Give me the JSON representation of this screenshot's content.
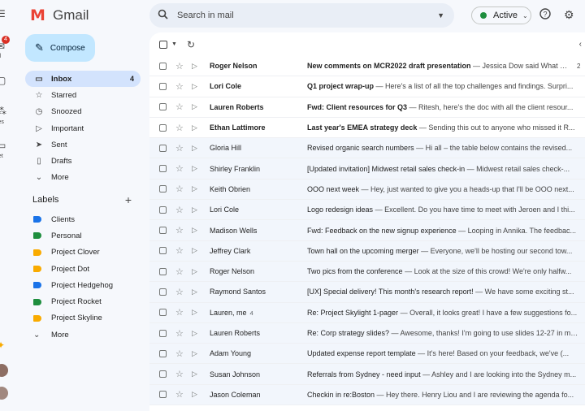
{
  "app": {
    "name": "Gmail"
  },
  "search": {
    "placeholder": "Search in mail"
  },
  "status": {
    "label": "Active",
    "color": "#1e8e3e"
  },
  "rail": {
    "items": [
      {
        "icon": "menu-icon",
        "label": ""
      },
      {
        "icon": "mail-icon",
        "label": "ail",
        "badge": "4"
      },
      {
        "icon": "chat-icon",
        "label": "at"
      },
      {
        "icon": "spaces-icon",
        "label": "ces"
      },
      {
        "icon": "meet-icon",
        "label": "eet"
      }
    ]
  },
  "compose": {
    "label": "Compose"
  },
  "nav": {
    "items": [
      {
        "label": "Inbox",
        "count": "4",
        "icon": "inbox-icon",
        "active": true
      },
      {
        "label": "Starred",
        "icon": "star-icon"
      },
      {
        "label": "Snoozed",
        "icon": "clock-icon"
      },
      {
        "label": "Important",
        "icon": "important-icon"
      },
      {
        "label": "Sent",
        "icon": "send-icon"
      },
      {
        "label": "Drafts",
        "icon": "draft-icon"
      },
      {
        "label": "More",
        "icon": "chevron-down-icon"
      }
    ]
  },
  "labels": {
    "title": "Labels",
    "items": [
      {
        "label": "Clients",
        "color": "#1a73e8"
      },
      {
        "label": "Personal",
        "color": "#1e8e3e"
      },
      {
        "label": "Project Clover",
        "color": "#f9ab00"
      },
      {
        "label": "Project Dot",
        "color": "#f9ab00"
      },
      {
        "label": "Project Hedgehog",
        "color": "#1a73e8"
      },
      {
        "label": "Project Rocket",
        "color": "#1e8e3e"
      },
      {
        "label": "Project Skyline",
        "color": "#f9ab00"
      }
    ],
    "more_label": "More"
  },
  "emails": [
    {
      "sender": "Roger Nelson",
      "subject": "New comments on MCR2022 draft presentation",
      "snippet": " — Jessica Dow said What ab...",
      "unread": true,
      "date": "2"
    },
    {
      "sender": "Lori Cole",
      "subject": "Q1 project wrap-up",
      "snippet": " — Here's a list of all the top challenges and findings. Surpri...",
      "unread": true
    },
    {
      "sender": "Lauren Roberts",
      "subject": "Fwd: Client resources for Q3",
      "snippet": " — Ritesh, here's the doc with all the client resour...",
      "unread": true
    },
    {
      "sender": "Ethan Lattimore",
      "subject": "Last year's EMEA strategy deck",
      "snippet": " — Sending this out to anyone who missed it R...",
      "unread": true
    },
    {
      "sender": "Gloria Hill",
      "subject": "Revised organic search numbers",
      "snippet": " — Hi all – the table below contains the revised...",
      "unread": false
    },
    {
      "sender": "Shirley Franklin",
      "subject": "[Updated invitation] Midwest retail sales check-in",
      "snippet": " — Midwest retail sales check-...",
      "unread": false
    },
    {
      "sender": "Keith Obrien",
      "subject": "OOO next week",
      "snippet": " — Hey, just wanted to give you a heads-up that I'll be OOO next...",
      "unread": false
    },
    {
      "sender": "Lori Cole",
      "subject": "Logo redesign ideas",
      "snippet": " — Excellent. Do you have time to meet with Jeroen and I thi...",
      "unread": false
    },
    {
      "sender": "Madison Wells",
      "subject": "Fwd: Feedback on the new signup experience",
      "snippet": " — Looping in Annika. The feedbac...",
      "unread": false
    },
    {
      "sender": "Jeffrey Clark",
      "subject": "Town hall on the upcoming merger",
      "snippet": " — Everyone, we'll be hosting our second tow...",
      "unread": false
    },
    {
      "sender": "Roger Nelson",
      "subject": "Two pics from the conference",
      "snippet": " — Look at the size of this crowd! We're only halfw...",
      "unread": false
    },
    {
      "sender": "Raymond Santos",
      "subject": "[UX] Special delivery! This month's research report!",
      "snippet": " — We have some exciting st...",
      "unread": false
    },
    {
      "sender": "Lauren, me",
      "sender_count": "4",
      "subject": "Re: Project Skylight 1-pager",
      "snippet": " — Overall, it looks great! I have a few suggestions fo...",
      "unread": false
    },
    {
      "sender": "Lauren Roberts",
      "subject": "Re: Corp strategy slides?",
      "snippet": " — Awesome, thanks! I'm going to use slides 12-27 in my...",
      "unread": false
    },
    {
      "sender": "Adam Young",
      "subject": "Updated expense report template",
      "snippet": " — It's here! Based on your feedback, we've (...",
      "unread": false
    },
    {
      "sender": "Susan Johnson",
      "subject": "Referrals from Sydney - need input",
      "snippet": " — Ashley and I are looking into the Sydney m...",
      "unread": false
    },
    {
      "sender": "Jason Coleman",
      "subject": "Checkin in re:Boston",
      "snippet": " — Hey there. Henry Liou and I are reviewing the agenda fo...",
      "unread": false
    }
  ]
}
